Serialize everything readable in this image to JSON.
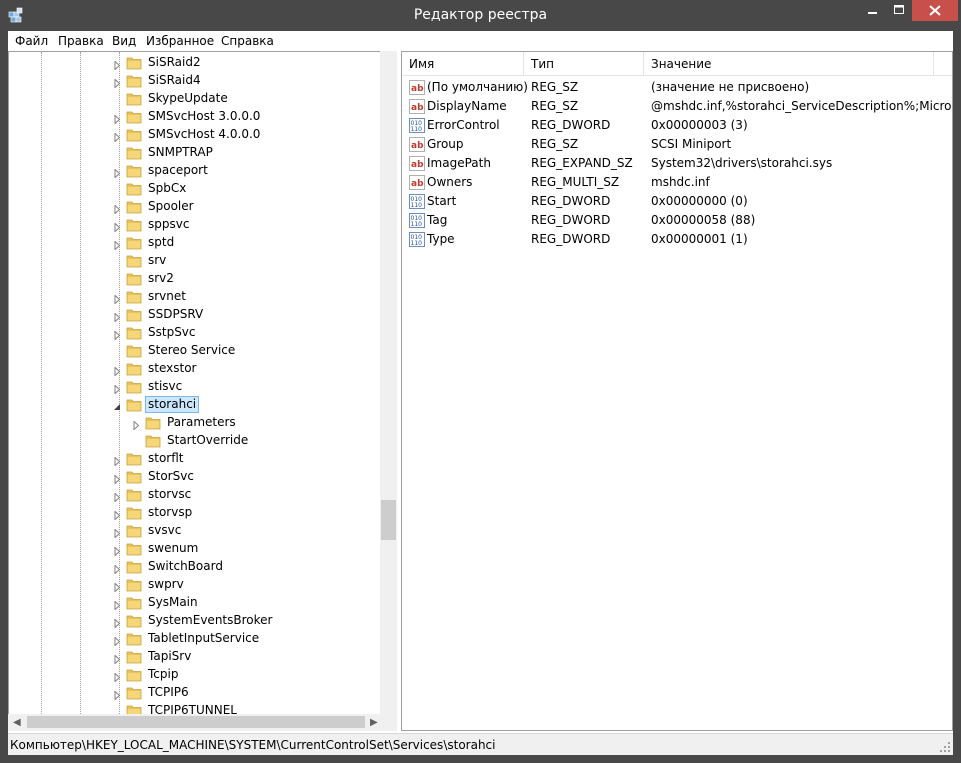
{
  "window": {
    "title": "Редактор реестра"
  },
  "menu": [
    "Файл",
    "Правка",
    "Вид",
    "Избранное",
    "Справка"
  ],
  "tree": {
    "items": [
      {
        "label": "SiSRaid2",
        "expander": "collapsed",
        "level": 0
      },
      {
        "label": "SiSRaid4",
        "expander": "collapsed",
        "level": 0
      },
      {
        "label": "SkypeUpdate",
        "expander": "none",
        "level": 0
      },
      {
        "label": "SMSvcHost 3.0.0.0",
        "expander": "collapsed",
        "level": 0
      },
      {
        "label": "SMSvcHost 4.0.0.0",
        "expander": "collapsed",
        "level": 0
      },
      {
        "label": "SNMPTRAP",
        "expander": "none",
        "level": 0
      },
      {
        "label": "spaceport",
        "expander": "collapsed",
        "level": 0
      },
      {
        "label": "SpbCx",
        "expander": "none",
        "level": 0
      },
      {
        "label": "Spooler",
        "expander": "collapsed",
        "level": 0
      },
      {
        "label": "sppsvc",
        "expander": "collapsed",
        "level": 0
      },
      {
        "label": "sptd",
        "expander": "collapsed",
        "level": 0
      },
      {
        "label": "srv",
        "expander": "none",
        "level": 0
      },
      {
        "label": "srv2",
        "expander": "none",
        "level": 0
      },
      {
        "label": "srvnet",
        "expander": "collapsed",
        "level": 0
      },
      {
        "label": "SSDPSRV",
        "expander": "collapsed",
        "level": 0
      },
      {
        "label": "SstpSvc",
        "expander": "collapsed",
        "level": 0
      },
      {
        "label": "Stereo Service",
        "expander": "none",
        "level": 0
      },
      {
        "label": "stexstor",
        "expander": "collapsed",
        "level": 0
      },
      {
        "label": "stisvc",
        "expander": "collapsed",
        "level": 0
      },
      {
        "label": "storahci",
        "expander": "expanded",
        "level": 0,
        "selected": true
      },
      {
        "label": "Parameters",
        "expander": "collapsed",
        "level": 1
      },
      {
        "label": "StartOverride",
        "expander": "none",
        "level": 1
      },
      {
        "label": "storflt",
        "expander": "collapsed",
        "level": 0
      },
      {
        "label": "StorSvc",
        "expander": "collapsed",
        "level": 0
      },
      {
        "label": "storvsc",
        "expander": "collapsed",
        "level": 0
      },
      {
        "label": "storvsp",
        "expander": "collapsed",
        "level": 0
      },
      {
        "label": "svsvc",
        "expander": "collapsed",
        "level": 0
      },
      {
        "label": "swenum",
        "expander": "collapsed",
        "level": 0
      },
      {
        "label": "SwitchBoard",
        "expander": "collapsed",
        "level": 0
      },
      {
        "label": "swprv",
        "expander": "collapsed",
        "level": 0
      },
      {
        "label": "SysMain",
        "expander": "collapsed",
        "level": 0
      },
      {
        "label": "SystemEventsBroker",
        "expander": "collapsed",
        "level": 0
      },
      {
        "label": "TabletInputService",
        "expander": "collapsed",
        "level": 0
      },
      {
        "label": "TapiSrv",
        "expander": "collapsed",
        "level": 0
      },
      {
        "label": "Tcpip",
        "expander": "collapsed",
        "level": 0
      },
      {
        "label": "TCPIP6",
        "expander": "collapsed",
        "level": 0
      },
      {
        "label": "TCPIP6TUNNEL",
        "expander": "none",
        "level": 0
      }
    ]
  },
  "list": {
    "columns": [
      "Имя",
      "Тип",
      "Значение"
    ],
    "rows": [
      {
        "icon": "string-value-icon",
        "name": "(По умолчанию)",
        "type": "REG_SZ",
        "value": "(значение не присвоено)"
      },
      {
        "icon": "string-value-icon",
        "name": "DisplayName",
        "type": "REG_SZ",
        "value": "@mshdc.inf,%storahci_ServiceDescription%;Micro..."
      },
      {
        "icon": "binary-value-icon",
        "name": "ErrorControl",
        "type": "REG_DWORD",
        "value": "0x00000003 (3)"
      },
      {
        "icon": "string-value-icon",
        "name": "Group",
        "type": "REG_SZ",
        "value": "SCSI Miniport"
      },
      {
        "icon": "string-value-icon",
        "name": "ImagePath",
        "type": "REG_EXPAND_SZ",
        "value": "System32\\drivers\\storahci.sys"
      },
      {
        "icon": "string-value-icon",
        "name": "Owners",
        "type": "REG_MULTI_SZ",
        "value": "mshdc.inf"
      },
      {
        "icon": "binary-value-icon",
        "name": "Start",
        "type": "REG_DWORD",
        "value": "0x00000000 (0)"
      },
      {
        "icon": "binary-value-icon",
        "name": "Tag",
        "type": "REG_DWORD",
        "value": "0x00000058 (88)"
      },
      {
        "icon": "binary-value-icon",
        "name": "Type",
        "type": "REG_DWORD",
        "value": "0x00000001 (1)"
      }
    ]
  },
  "status": {
    "path": "Компьютер\\HKEY_LOCAL_MACHINE\\SYSTEM\\CurrentControlSet\\Services\\storahci"
  },
  "colors": {
    "frame": "#484848",
    "close_button": "#c7504b",
    "selection": "#cce8ff",
    "folder": "#e8c25a"
  }
}
